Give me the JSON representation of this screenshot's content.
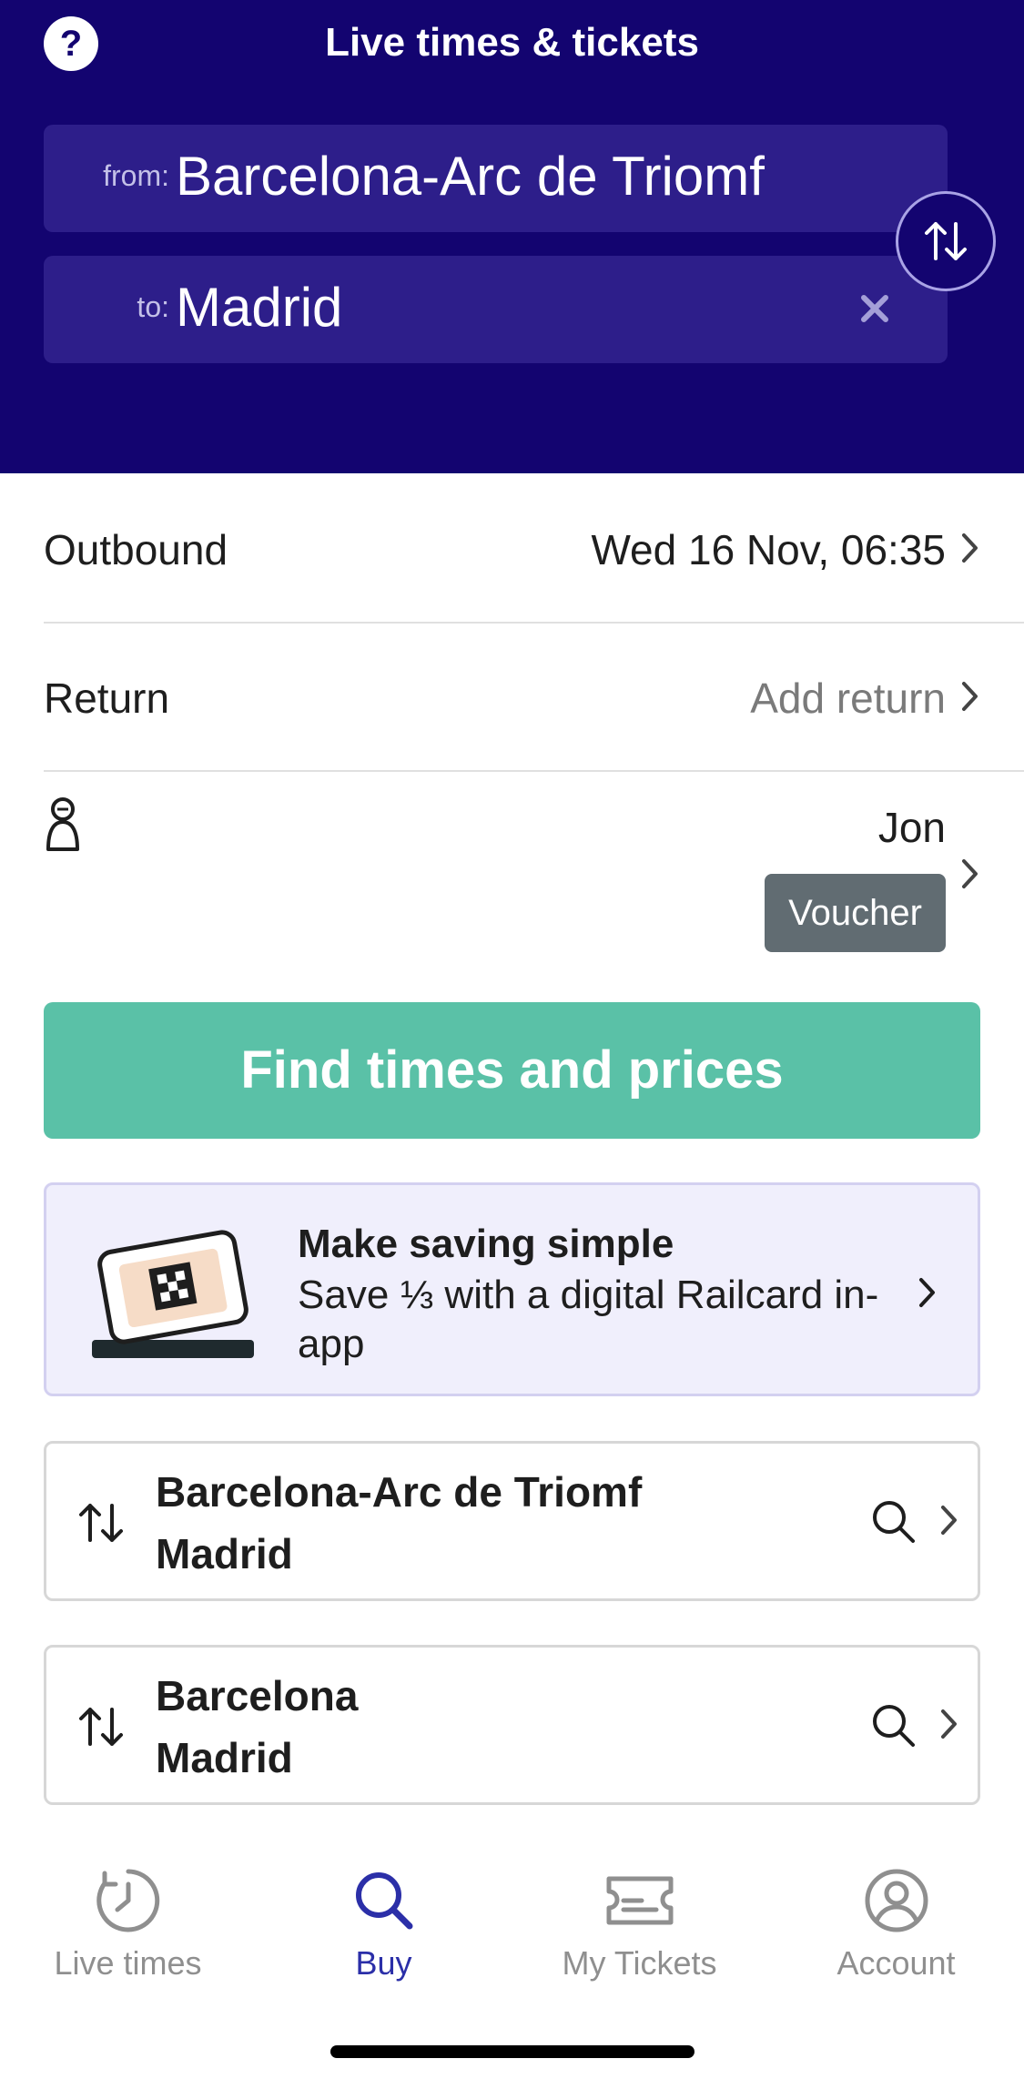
{
  "header": {
    "help_label": "?",
    "title": "Live times & tickets",
    "from_label": "from:",
    "from_value": "Barcelona-Arc de Triomf",
    "to_label": "to:",
    "to_value": "Madrid",
    "bg_color": "#130470"
  },
  "journey": {
    "outbound_label": "Outbound",
    "outbound_value": "Wed 16 Nov, 06:35",
    "return_label": "Return",
    "return_value": "Add return"
  },
  "passenger": {
    "name": "Jon",
    "voucher_label": "Voucher"
  },
  "find_button": {
    "label": "Find times and prices",
    "color": "#5ac1a7"
  },
  "promo": {
    "title": "Make saving simple",
    "body": "Save ⅓ with a digital Railcard in-app"
  },
  "recent_searches": [
    {
      "from": "Barcelona-Arc de Triomf",
      "to": "Madrid"
    },
    {
      "from": "Barcelona",
      "to": "Madrid"
    }
  ],
  "tabbar": {
    "tabs": [
      {
        "label": "Live times",
        "icon": "clock-icon"
      },
      {
        "label": "Buy",
        "icon": "search-icon",
        "active": true
      },
      {
        "label": "My Tickets",
        "icon": "ticket-icon"
      },
      {
        "label": "Account",
        "icon": "account-icon"
      }
    ],
    "active_color": "#2b2fa8"
  }
}
